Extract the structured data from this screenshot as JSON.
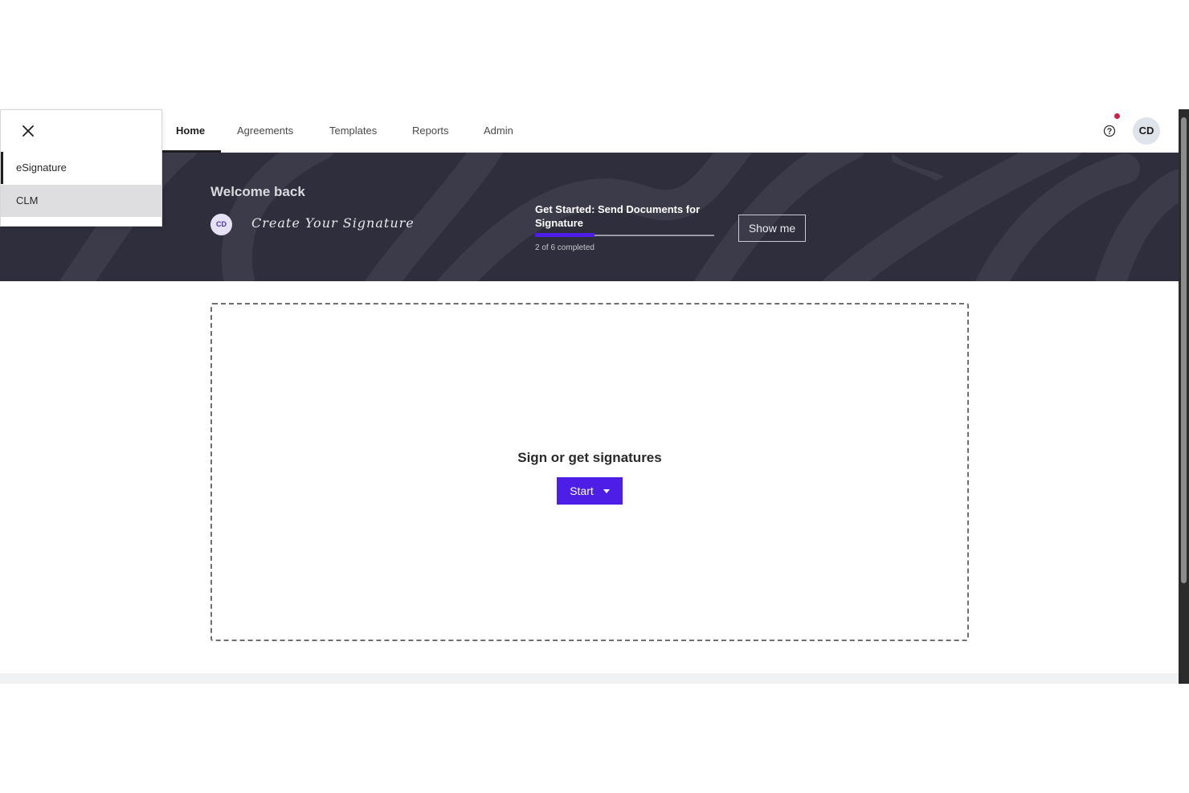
{
  "nav": {
    "tabs": [
      {
        "label": "Home",
        "active": true
      },
      {
        "label": "Agreements"
      },
      {
        "label": "Templates"
      },
      {
        "label": "Reports"
      },
      {
        "label": "Admin"
      }
    ],
    "help_icon": "question-circle-icon",
    "user_initials": "CD",
    "notification_color": "#cc1f4a"
  },
  "hero": {
    "welcome": "Welcome back",
    "avatar_initials": "CD",
    "signature_prompt": "Create Your Signature",
    "get_started_title": "Get Started: Send Documents for Signature",
    "progress_completed": 2,
    "progress_total": 6,
    "progress_text": "2 of 6 completed",
    "show_me_label": "Show me"
  },
  "main": {
    "dropzone_title": "Sign or get signatures",
    "start_label": "Start"
  },
  "app_switcher": {
    "close_icon": "close-icon",
    "items": [
      {
        "label": "eSignature",
        "selected": true
      },
      {
        "label": "CLM"
      }
    ]
  },
  "colors": {
    "accent": "#4c1ee6",
    "hero_bg": "#2f2e3c"
  }
}
